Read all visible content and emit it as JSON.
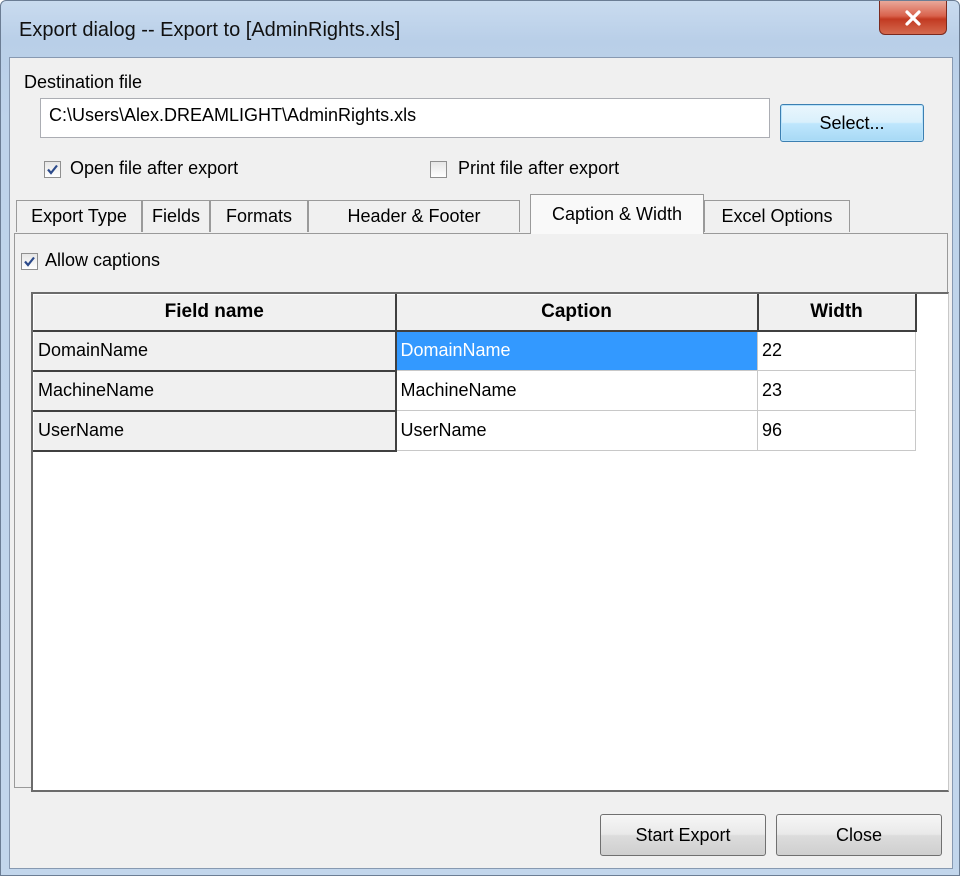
{
  "window": {
    "title": "Export dialog -- Export to [AdminRights.xls]",
    "close_icon": "close-icon"
  },
  "destination": {
    "label": "Destination file",
    "path": "C:\\Users\\Alex.DREAMLIGHT\\AdminRights.xls",
    "select_label": "Select..."
  },
  "options": {
    "open_after_label": "Open file after export",
    "open_after_checked": true,
    "print_after_label": "Print file after export",
    "print_after_checked": false
  },
  "tabs": [
    {
      "label": "Export Type",
      "active": false
    },
    {
      "label": "Fields",
      "active": false
    },
    {
      "label": "Formats",
      "active": false
    },
    {
      "label": "Header & Footer",
      "active": false
    },
    {
      "label": "Caption & Width",
      "active": true
    },
    {
      "label": "Excel Options",
      "active": false
    }
  ],
  "caption_tab": {
    "allow_captions_label": "Allow captions",
    "allow_captions_checked": true,
    "columns": [
      "Field name",
      "Caption",
      "Width"
    ],
    "rows": [
      {
        "field": "DomainName",
        "caption": "DomainName",
        "width": "22",
        "selected": true
      },
      {
        "field": "MachineName",
        "caption": "MachineName",
        "width": "23",
        "selected": false
      },
      {
        "field": "UserName",
        "caption": "UserName",
        "width": "96",
        "selected": false
      }
    ]
  },
  "footer": {
    "start_label": "Start Export",
    "close_label": "Close"
  },
  "colors": {
    "selection": "#3399ff",
    "close_button": "#c23a22"
  }
}
